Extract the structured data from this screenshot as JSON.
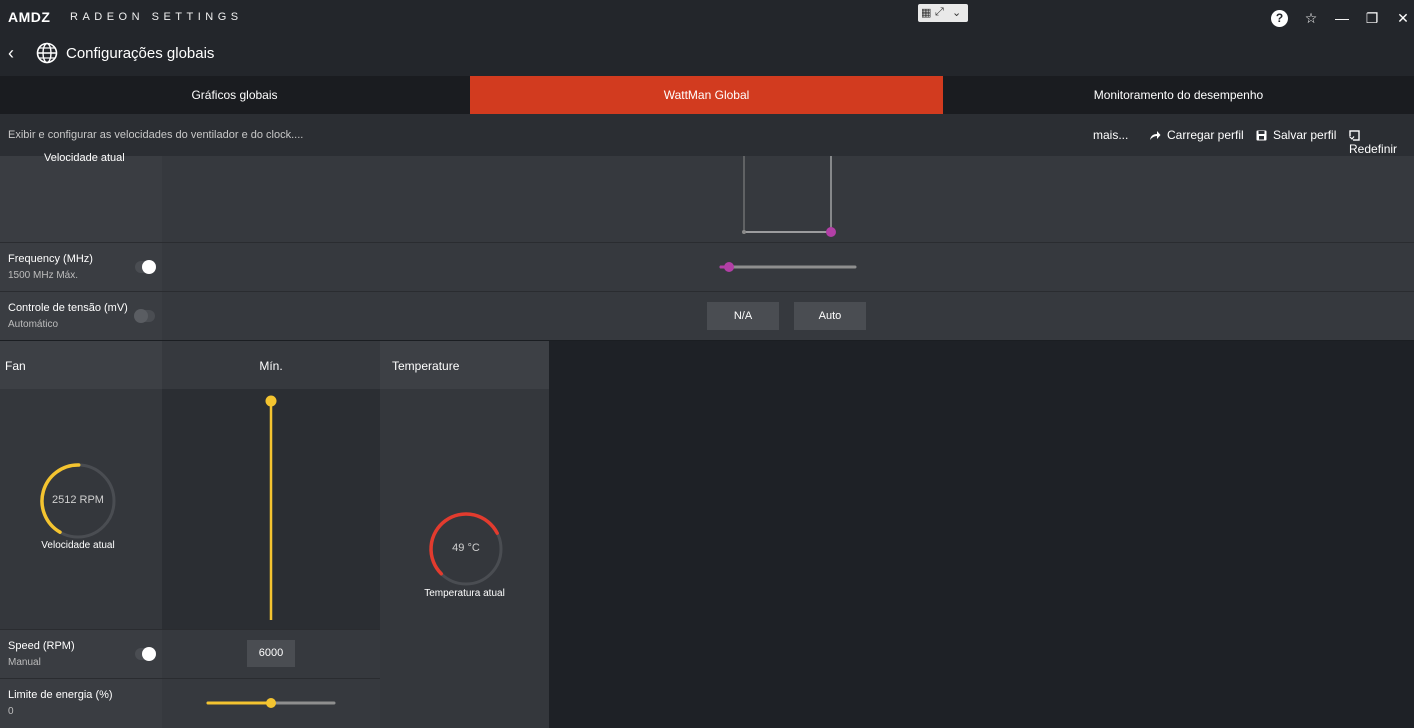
{
  "app": {
    "brand": "AMDZ",
    "title": "RADEON SETTINGS"
  },
  "header": {
    "title": "Configurações globais"
  },
  "tabs": [
    {
      "label": "Gráficos globais",
      "active": false
    },
    {
      "label": "WattMan Global",
      "active": true
    },
    {
      "label": "Monitoramento do desempenho",
      "active": false
    }
  ],
  "action_bar": {
    "description": "Exibir e configurar as velocidades do ventilador e do clock....",
    "more": "mais...",
    "load_profile": "Carregar perfil",
    "save_profile": "Salvar perfil",
    "reset": "Redefinir"
  },
  "gpu": {
    "top_label": "Velocidade atual",
    "frequency": {
      "label": "Frequency (MHz)",
      "sub": "1500 MHz Máx.",
      "enabled": true,
      "slider_fraction": 0.06
    },
    "voltage": {
      "label": "Controle de tensão (mV)",
      "sub": "Automático",
      "enabled": false,
      "value": "N/A",
      "mode": "Auto"
    }
  },
  "fan": {
    "title": "Fan",
    "column_label": "Mín.",
    "rpm_text": "2512 RPM",
    "rpm_gauge_fraction": 0.42,
    "current_label": "Velocidade atual",
    "speed": {
      "label": "Speed (RPM)",
      "sub": "Manual",
      "enabled": true,
      "value": "6000"
    },
    "power_limit": {
      "label": "Limite de energia (%)",
      "sub": "0",
      "slider_fraction": 0.5
    }
  },
  "temperature": {
    "title": "Temperature",
    "value_text": "49 °C",
    "gauge_fraction": 0.55,
    "current_label": "Temperatura atual"
  },
  "colors": {
    "accent": "#d23b1f",
    "fan_yellow": "#f4c430",
    "temp_red": "#e23b2e",
    "slider_magenta": "#b23fa6"
  }
}
